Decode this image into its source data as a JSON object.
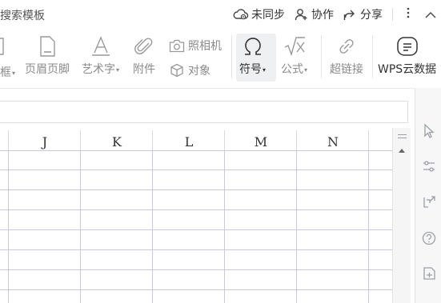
{
  "topbar": {
    "search_label": "搜索模板",
    "sync_label": "未同步",
    "collab_label": "协作",
    "share_label": "分享"
  },
  "ribbon": {
    "textbox_label": "框",
    "header_footer_label": "页眉页脚",
    "wordart_label": "艺术字",
    "attachment_label": "附件",
    "camera_label": "照相机",
    "object_label": "对象",
    "symbol_label": "符号",
    "formula_label": "公式",
    "hyperlink_label": "超链接",
    "wps_cloud_label": "WPS云数据"
  },
  "sheet": {
    "columns": [
      "J",
      "K",
      "L",
      "M",
      "N"
    ]
  },
  "colors": {
    "grid_line": "#c9c9e3",
    "ribbon_text_disabled": "#8a8a8a",
    "selected_bg": "#eef0f2"
  }
}
